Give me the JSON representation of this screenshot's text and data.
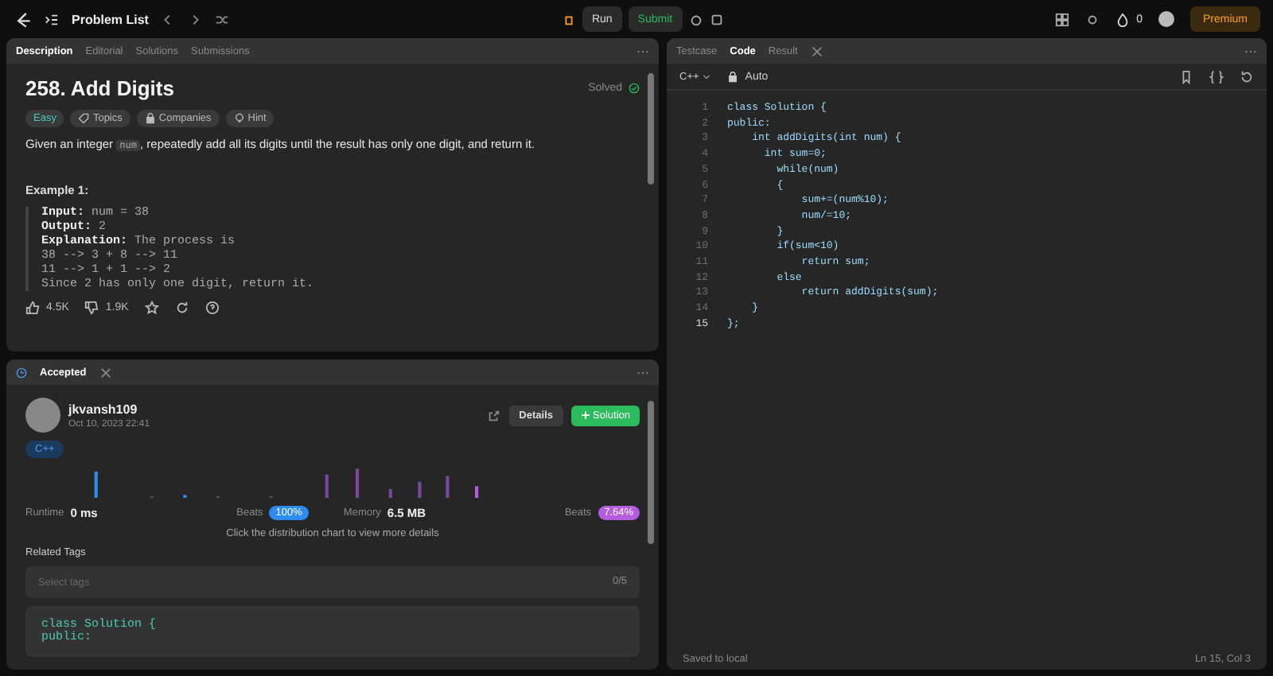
{
  "topbar": {
    "title": "Problem List",
    "run": "Run",
    "submit": "Submit",
    "streak": "0",
    "premium": "Premium"
  },
  "description_panel": {
    "tabs": [
      {
        "label": "Description",
        "selected": true
      },
      {
        "label": "Editorial",
        "selected": false
      },
      {
        "label": "Solutions",
        "selected": false
      },
      {
        "label": "Submissions",
        "selected": false
      }
    ],
    "title": "258. Add Digits",
    "status": "Solved",
    "tags": [
      {
        "label": "Easy",
        "kind": "difficulty"
      },
      {
        "label": "Topics",
        "kind": "topics"
      },
      {
        "label": "Companies",
        "kind": "companies"
      },
      {
        "label": "Hint",
        "kind": "hint"
      }
    ],
    "statement_before": "Given an integer",
    "statement_code": "num",
    "statement_after": ", repeatedly add all its digits until the result has only one digit, and return it.",
    "example_title": "Example 1:",
    "example_lines": [
      {
        "label": "Input:",
        "text": "num = 38"
      },
      {
        "label": "Output:",
        "text": "2"
      },
      {
        "label": "Explanation:",
        "text": "The process is"
      },
      {
        "text": "38 --> 3 + 8 --> 11"
      },
      {
        "text": "11 --> 1 + 1 --> 2"
      },
      {
        "text": "Since 2 has only one digit, return it."
      }
    ],
    "likes": "4.5K",
    "dislikes": "1.9K"
  },
  "result_panel": {
    "tab": "Accepted",
    "user": "jkvansh109",
    "date": "Oct 10, 2023 22:41",
    "details": "Details",
    "solution": "Solution",
    "language": "C++",
    "runtime_label": "Runtime",
    "runtime": "0 ms",
    "runtime_beats_label": "Beats",
    "runtime_beats": "100%",
    "memory_label": "Memory",
    "memory": "6.5 MB",
    "memory_beats_label": "Beats",
    "memory_beats": "7.64%",
    "hint": "Click the distribution chart to view more details",
    "related_tags_label": "Related Tags",
    "tags_placeholder": "Select tags",
    "tags_count": "0/5",
    "code_preview": [
      "class Solution {",
      "public:"
    ]
  },
  "code_panel": {
    "tabs": [
      {
        "label": "Testcase",
        "selected": false
      },
      {
        "label": "Code",
        "selected": true
      },
      {
        "label": "Result",
        "selected": false
      }
    ],
    "language": "C++",
    "mode": "Auto",
    "lines": [
      {
        "number": "1",
        "text": "class Solution {"
      },
      {
        "number": "2",
        "text": "public:"
      },
      {
        "number": "3",
        "text": "    int addDigits(int num) {"
      },
      {
        "number": "4",
        "text": "      int sum=0;"
      },
      {
        "number": "5",
        "text": "        while(num)"
      },
      {
        "number": "6",
        "text": "        {"
      },
      {
        "number": "7",
        "text": "            sum+=(num%10);"
      },
      {
        "number": "8",
        "text": "            num/=10;"
      },
      {
        "number": "9",
        "text": "        }"
      },
      {
        "number": "10",
        "text": "        if(sum<10)"
      },
      {
        "number": "11",
        "text": "            return sum;"
      },
      {
        "number": "12",
        "text": "        else"
      },
      {
        "number": "13",
        "text": "            return addDigits(sum);"
      },
      {
        "number": "14",
        "text": "    }"
      },
      {
        "number": "15",
        "text": "};"
      }
    ],
    "saved": "Saved to local",
    "cursor": "Ln 15, Col 3"
  }
}
